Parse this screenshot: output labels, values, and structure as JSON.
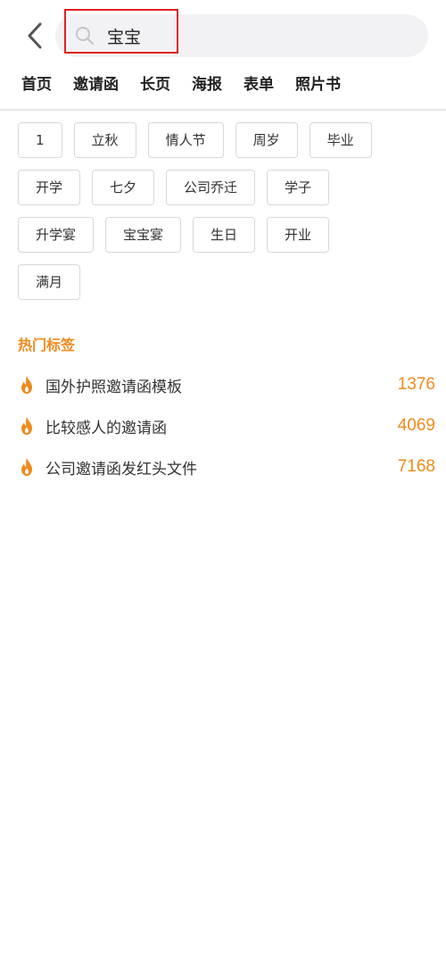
{
  "search": {
    "value": "宝宝",
    "placeholder": ""
  },
  "category_tabs": [
    "首页",
    "邀请函",
    "长页",
    "海报",
    "表单",
    "照片书"
  ],
  "tag_rows": [
    [
      "1",
      "立秋",
      "情人节",
      "周岁",
      "毕业"
    ],
    [
      "开学",
      "七夕",
      "公司乔迁",
      "学子"
    ],
    [
      "升学宴",
      "宝宝宴",
      "生日",
      "开业"
    ],
    [
      "满月"
    ]
  ],
  "hot": {
    "title": "热门标签",
    "items": [
      {
        "label": "国外护照邀请函模板",
        "count": "1376"
      },
      {
        "label": "比较感人的邀请函",
        "count": "4069"
      },
      {
        "label": "公司邀请函发红头文件",
        "count": "7168"
      }
    ]
  },
  "colors": {
    "accent": "#f08a1c",
    "highlight_border": "#e02020",
    "search_bg": "#f2f2f4",
    "tag_border": "#d8d8d8"
  },
  "icons": {
    "back": "chevron-left-icon",
    "search": "search-icon",
    "hot": "fire-icon"
  }
}
